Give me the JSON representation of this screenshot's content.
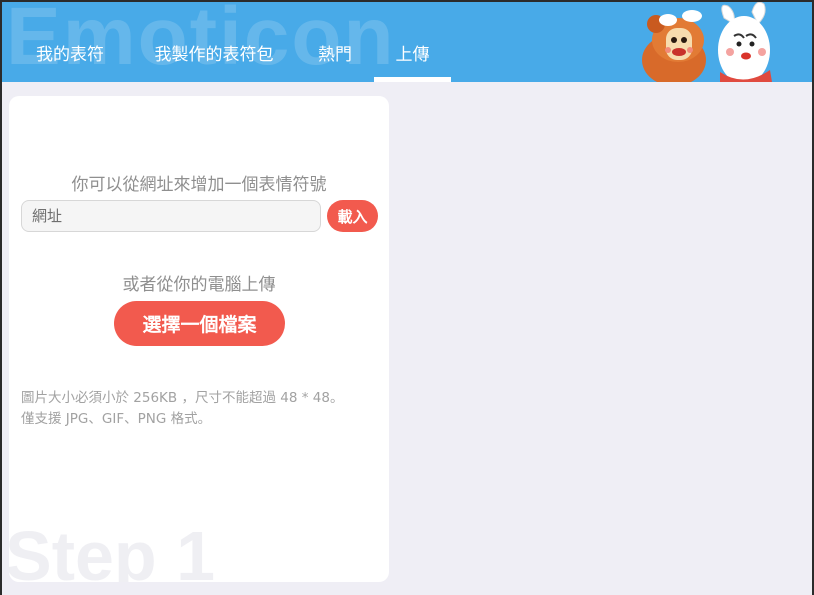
{
  "header": {
    "watermark": "Emoticon",
    "tabs": [
      {
        "label": "我的表符",
        "active": false
      },
      {
        "label": "我製作的表符包",
        "active": false
      },
      {
        "label": "熱門",
        "active": false
      },
      {
        "label": "上傳",
        "active": true
      }
    ],
    "mascot_icon": "mascot-illustration"
  },
  "upload_panel": {
    "url_hint": "你可以從網址來增加一個表情符號",
    "url_placeholder": "網址",
    "load_label": "載入",
    "computer_hint": "或者從你的電腦上傳",
    "choose_file_label": "選擇一個檔案",
    "note_line1": "圖片大小必須小於 256KB ，尺寸不能超過 48 * 48。",
    "note_line2": "僅支援 JPG、GIF、PNG 格式。",
    "step_watermark": "Step 1"
  },
  "colors": {
    "header_bg": "#48aae8",
    "accent": "#f25a4e",
    "page_bg": "#efeef5"
  }
}
